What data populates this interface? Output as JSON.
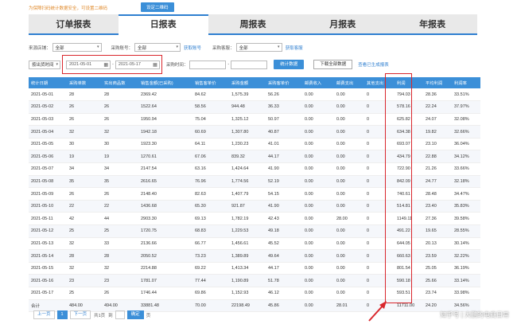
{
  "notice": {
    "text": "为保障扫码统计数据安全，可设置二维码",
    "button": "设定二维码"
  },
  "tabs": [
    {
      "label": "订单报表"
    },
    {
      "label": "日报表"
    },
    {
      "label": "周报表"
    },
    {
      "label": "月报表"
    },
    {
      "label": "年报表"
    }
  ],
  "filters": {
    "shop_label": "来源店铺：",
    "shop_value": "全部",
    "account_label": "采购账号：",
    "account_value": "全部",
    "account_link": "获取账号",
    "buyer_label": "采购客服：",
    "buyer_value": "全部",
    "buyer_link": "获取客服",
    "date_type": "按出货时间",
    "date_start": "2021-05-01",
    "date_sep": "-",
    "date_end": "2021-05-17",
    "purchase_time_label": "采购时间：",
    "stat_button": "统计数据",
    "download_button": "下载全部数据",
    "generated_link": "查看已生成报表"
  },
  "table": {
    "headers": [
      "统计日期",
      "采购单数",
      "实出商品数",
      "销售金额(已采购)",
      "销售客单价",
      "采购金额",
      "采购客单价",
      "邮费收入",
      "邮费支出",
      "其他支出",
      "利润",
      "平均利润",
      "利润率"
    ],
    "rows": [
      [
        "2021-05-01",
        "28",
        "28",
        "2369.42",
        "84.62",
        "1,575.39",
        "56.26",
        "0.00",
        "0.00",
        "0",
        "794.03",
        "28.36",
        "33.51%"
      ],
      [
        "2021-05-02",
        "26",
        "26",
        "1522.64",
        "58.56",
        "944.48",
        "36.33",
        "0.00",
        "0.00",
        "0",
        "578.16",
        "22.24",
        "37.97%"
      ],
      [
        "2021-05-03",
        "26",
        "26",
        "1950.94",
        "75.04",
        "1,325.12",
        "50.97",
        "0.00",
        "0.00",
        "0",
        "625.82",
        "24.07",
        "32.08%"
      ],
      [
        "2021-05-04",
        "32",
        "32",
        "1942.18",
        "60.69",
        "1,307.80",
        "40.87",
        "0.00",
        "0.00",
        "0",
        "634.38",
        "19.82",
        "32.66%"
      ],
      [
        "2021-05-05",
        "30",
        "30",
        "1923.30",
        "64.11",
        "1,230.23",
        "41.01",
        "0.00",
        "0.00",
        "0",
        "693.07",
        "23.10",
        "36.04%"
      ],
      [
        "2021-05-06",
        "19",
        "19",
        "1270.61",
        "67.06",
        "839.32",
        "44.17",
        "0.00",
        "0.00",
        "0",
        "434.79",
        "22.88",
        "34.12%"
      ],
      [
        "2021-05-07",
        "34",
        "34",
        "2147.54",
        "63.16",
        "1,424.64",
        "41.90",
        "0.00",
        "0.00",
        "0",
        "722.90",
        "21.26",
        "33.66%"
      ],
      [
        "2021-05-08",
        "35",
        "35",
        "2616.65",
        "76.96",
        "1,774.56",
        "52.19",
        "0.00",
        "0.00",
        "0",
        "842.09",
        "24.77",
        "32.18%"
      ],
      [
        "2021-05-09",
        "26",
        "26",
        "2148.40",
        "82.63",
        "1,407.79",
        "54.15",
        "0.00",
        "0.00",
        "0",
        "740.61",
        "28.48",
        "34.47%"
      ],
      [
        "2021-05-10",
        "22",
        "22",
        "1436.68",
        "65.30",
        "921.87",
        "41.90",
        "0.00",
        "0.00",
        "0",
        "514.81",
        "23.40",
        "35.83%"
      ],
      [
        "2021-05-11",
        "42",
        "44",
        "2903.30",
        "69.13",
        "1,782.19",
        "42.43",
        "0.00",
        "28.00",
        "0",
        "1149.11",
        "27.36",
        "39.58%"
      ],
      [
        "2021-05-12",
        "25",
        "25",
        "1720.75",
        "68.83",
        "1,229.53",
        "49.18",
        "0.00",
        "0.00",
        "0",
        "491.22",
        "19.65",
        "28.55%"
      ],
      [
        "2021-05-13",
        "32",
        "33",
        "2136.66",
        "66.77",
        "1,456.61",
        "45.52",
        "0.00",
        "0.00",
        "0",
        "644.05",
        "20.13",
        "30.14%"
      ],
      [
        "2021-05-14",
        "28",
        "28",
        "2050.52",
        "73.23",
        "1,389.89",
        "49.64",
        "0.00",
        "0.00",
        "0",
        "660.63",
        "23.59",
        "32.22%"
      ],
      [
        "2021-05-15",
        "32",
        "32",
        "2214.88",
        "69.22",
        "1,413.34",
        "44.17",
        "0.00",
        "0.00",
        "0",
        "801.54",
        "25.05",
        "36.19%"
      ],
      [
        "2021-05-16",
        "23",
        "23",
        "1781.07",
        "77.44",
        "1,190.89",
        "51.78",
        "0.00",
        "0.00",
        "0",
        "590.18",
        "25.66",
        "33.14%"
      ],
      [
        "2021-05-17",
        "25",
        "26",
        "1746.44",
        "69.86",
        "1,152.93",
        "46.12",
        "0.00",
        "0.00",
        "0",
        "593.51",
        "23.74",
        "33.98%"
      ],
      [
        "合计",
        "484.00",
        "494.00",
        "33881.48",
        "70.00",
        "22198.49",
        "45.86",
        "0.00",
        "28.01",
        "0",
        "11711.00",
        "24.20",
        "34.56%"
      ]
    ]
  },
  "pager": {
    "prev": "上一页",
    "page": "1",
    "next": "下一页",
    "total": "共1页",
    "goto": "到",
    "confirm": "确定",
    "page_unit": "页"
  },
  "watermark": "知乎号 | 大鹏的电商日常"
}
